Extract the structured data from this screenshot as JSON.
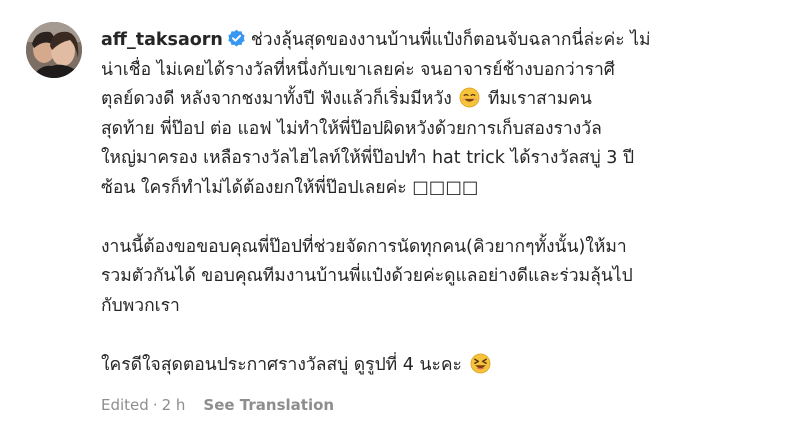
{
  "comment": {
    "username": "aff_taksaorn",
    "verified": true,
    "paragraph1": [
      "ช่วงลุ้นสุดของงานบ้านพี่แป๋งก็ตอนจับฉลากนี่ล่ะค่ะ ไม่",
      "น่าเชื่อ ไม่เคยได้รางวัลที่หนึ่งกับเขาเลยค่ะ จนอาจารย์ช้างบอกว่าราศี",
      "ตุลย์ดวงดี หลังจากชงมาทั้งปี ฟังแล้วก็เริ่มมีหวัง",
      "ทีมเราสามคน",
      "สุดท้าย พี่ป๊อป ต่อ แอฟ ไม่ทำให้พี่ป๊อปผิดหวังด้วยการเก็บสองรางวัล",
      "ใหญ่มาครอง เหลือรางวัลไฮไลท์ให้พี่ป๊อปทำ hat trick ได้รางวัลสบู่ 3 ปี",
      "ซ้อน ใครก็ทำไม่ได้ต้องยกให้พี่ป๊อปเลยค่ะ □□□□"
    ],
    "paragraph2": [
      "งานนี้ต้องขอขอบคุณพี่ป๊อปที่ช่วยจัดการนัดทุกคน(คิวยากๆทั้งนั้น)ให้มา",
      "รวมตัวกันได้ ขอบคุณทีมงานบ้านพี่แป๋งด้วยค่ะดูแลอย่างดีและร่วมลุ้นไป",
      "กับพวกเรา"
    ],
    "paragraph3": "ใครดีใจสุดตอนประกาศรางวัลสบู่ ดูรูปที่ 4 นะคะ",
    "emoji_1": "smiling-face-emoji",
    "emoji_2": "laughing-squint-emoji"
  },
  "meta": {
    "edited": "Edited",
    "separator": "·",
    "time": "2 h",
    "see_translation": "See Translation"
  },
  "colors": {
    "text": "#262626",
    "meta": "#8e8e8e",
    "verified": "#3897f0",
    "emoji": "#f7c33b"
  }
}
